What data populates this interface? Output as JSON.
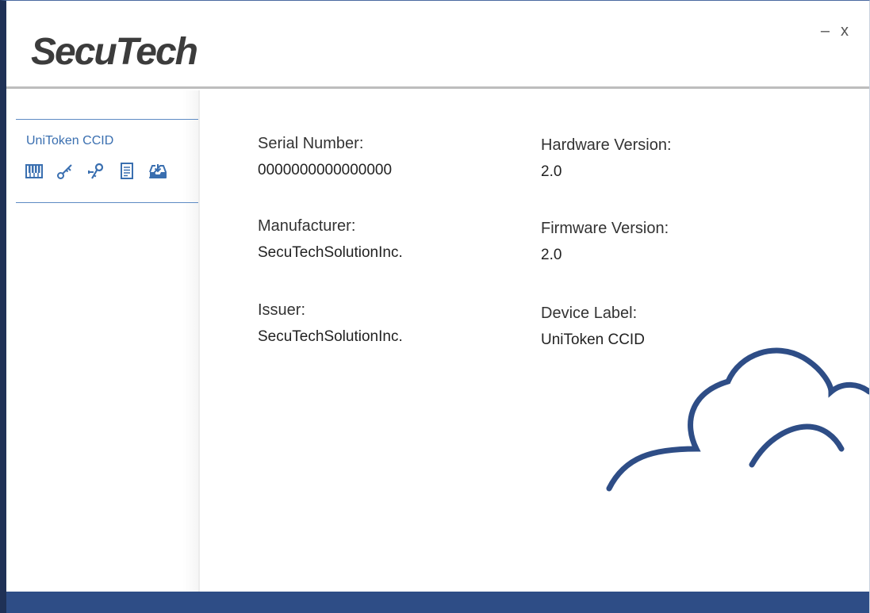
{
  "app": {
    "logo_text": "SecuTech"
  },
  "window_controls": {
    "minimize": "–",
    "close": "x"
  },
  "sidebar": {
    "device_name": "UniToken CCID",
    "icons": [
      {
        "name": "keypad-icon"
      },
      {
        "name": "key-icon"
      },
      {
        "name": "keys-icon"
      },
      {
        "name": "document-icon"
      },
      {
        "name": "download-tray-icon"
      }
    ]
  },
  "details": {
    "serial_number": {
      "label": "Serial Number:",
      "value": "0000000000000000"
    },
    "manufacturer": {
      "label": "Manufacturer:",
      "value": "SecuTechSolutionInc."
    },
    "issuer": {
      "label": "Issuer:",
      "value": "SecuTechSolutionInc."
    },
    "hardware_version": {
      "label": "Hardware Version:",
      "value": "2.0"
    },
    "firmware_version": {
      "label": "Firmware Version:",
      "value": "2.0"
    },
    "device_label": {
      "label": "Device Label:",
      "value": "UniToken CCID"
    }
  },
  "colors": {
    "accent": "#2e4d86",
    "link_blue": "#3a6fb0",
    "frame": "#1f3156"
  }
}
